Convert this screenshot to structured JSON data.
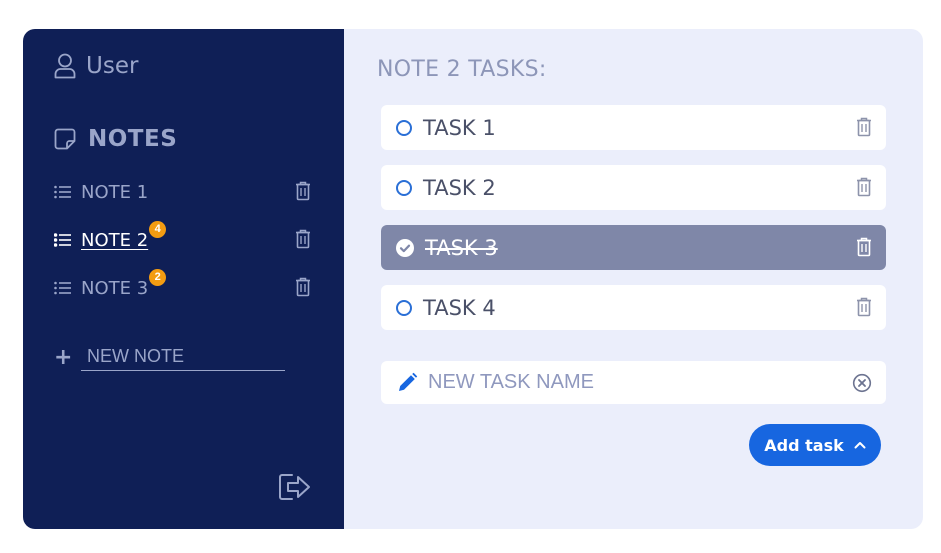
{
  "sidebar": {
    "user_label": "User",
    "notes_header": "NOTES",
    "notes": [
      {
        "label": "NOTE 1",
        "badge": "",
        "active": false
      },
      {
        "label": "NOTE 2",
        "badge": "4",
        "active": true
      },
      {
        "label": "NOTE 3",
        "badge": "2",
        "active": false
      }
    ],
    "new_note_placeholder": "NEW NOTE"
  },
  "main": {
    "title": "NOTE 2 TASKS:",
    "tasks": [
      {
        "label": "TASK 1",
        "done": false
      },
      {
        "label": "TASK 2",
        "done": false
      },
      {
        "label": "TASK 3",
        "done": true
      },
      {
        "label": "TASK 4",
        "done": false
      }
    ],
    "new_task_placeholder": "NEW TASK NAME",
    "add_button_label": "Add task"
  },
  "colors": {
    "sidebar_bg": "#0f1f56",
    "main_bg": "#ebeefb",
    "accent": "#1766e0",
    "badge": "#f39c12",
    "done_task_bg": "#7f87a8"
  },
  "icons": {
    "user": "user-icon",
    "notes": "note-icon",
    "list": "list-icon",
    "trash": "trash-icon",
    "plus": "plus-icon",
    "logout": "logout-icon",
    "circle": "circle-icon",
    "check": "check-circle-icon",
    "pencil": "pencil-icon",
    "clear": "clear-icon",
    "chevron": "chevron-up-icon"
  }
}
